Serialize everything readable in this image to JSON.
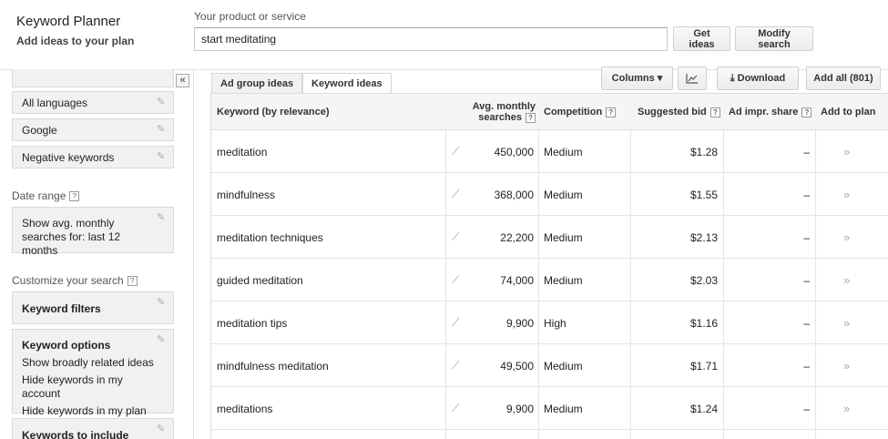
{
  "header": {
    "title": "Keyword Planner",
    "subtitle": "Add ideas to your plan",
    "product_label": "Your product or service",
    "search_value": "start meditating",
    "get_ideas": "Get ideas",
    "modify_search": "Modify search"
  },
  "sidebar": {
    "collapse_glyph": "«",
    "targeting": [
      "All languages",
      "Google",
      "Negative keywords"
    ],
    "date_range_label": "Date range",
    "date_range_value": "Show avg. monthly searches for: last 12 months",
    "customize_label": "Customize your search",
    "keyword_filters": "Keyword filters",
    "keyword_options": {
      "title": "Keyword options",
      "lines": [
        "Show broadly related ideas",
        "Hide keywords in my account",
        "Hide keywords in my plan"
      ]
    },
    "keywords_to_include": "Keywords to include",
    "help_glyph": "?"
  },
  "tabs": [
    {
      "label": "Ad group ideas",
      "active": false
    },
    {
      "label": "Keyword ideas",
      "active": true
    }
  ],
  "toolbar": {
    "columns": "Columns ▾",
    "chart_icon": "chart-icon",
    "download": "Download",
    "add_all": "Add all (801)"
  },
  "table": {
    "headers": {
      "keyword": "Keyword (by relevance)",
      "searches_1": "Avg. monthly",
      "searches_2": "searches",
      "competition": "Competition",
      "bid": "Suggested bid",
      "impr": "Ad impr. share",
      "add": "Add to plan"
    },
    "rows": [
      {
        "keyword": "meditation",
        "searches": "450,000",
        "competition": "Medium",
        "bid": "$1.28",
        "impr": "–"
      },
      {
        "keyword": "mindfulness",
        "searches": "368,000",
        "competition": "Medium",
        "bid": "$1.55",
        "impr": "–"
      },
      {
        "keyword": "meditation techniques",
        "searches": "22,200",
        "competition": "Medium",
        "bid": "$2.13",
        "impr": "–"
      },
      {
        "keyword": "guided meditation",
        "searches": "74,000",
        "competition": "Medium",
        "bid": "$2.03",
        "impr": "–"
      },
      {
        "keyword": "meditation tips",
        "searches": "9,900",
        "competition": "High",
        "bid": "$1.16",
        "impr": "–"
      },
      {
        "keyword": "mindfulness meditation",
        "searches": "49,500",
        "competition": "Medium",
        "bid": "$1.71",
        "impr": "–"
      },
      {
        "keyword": "meditations",
        "searches": "9,900",
        "competition": "Medium",
        "bid": "$1.24",
        "impr": "–"
      }
    ],
    "add_glyph": "»",
    "trend_glyph": "⟋"
  }
}
